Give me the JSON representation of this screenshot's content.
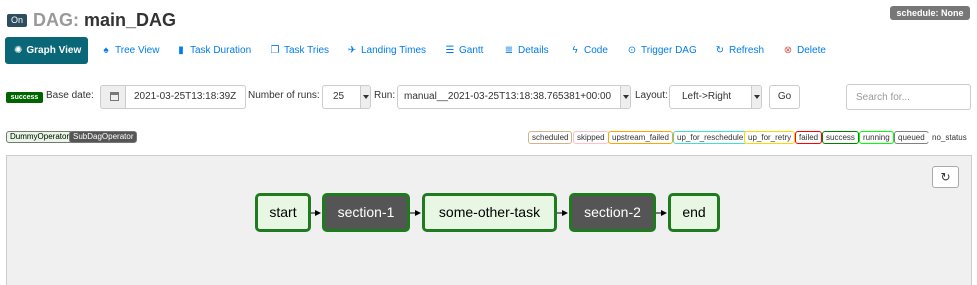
{
  "header": {
    "toggle_label": "On",
    "title_prefix": "DAG:",
    "dag_id": "main_DAG",
    "schedule_badge": "schedule: None"
  },
  "nav": {
    "items": [
      {
        "label": "Graph View",
        "icon": "asterisk-icon",
        "active": true
      },
      {
        "label": "Tree View",
        "icon": "tree-icon"
      },
      {
        "label": "Task Duration",
        "icon": "bar-chart-icon"
      },
      {
        "label": "Task Tries",
        "icon": "files-icon"
      },
      {
        "label": "Landing Times",
        "icon": "plane-icon"
      },
      {
        "label": "Gantt",
        "icon": "gantt-icon"
      },
      {
        "label": "Details",
        "icon": "list-icon"
      },
      {
        "label": "Code",
        "icon": "flash-icon"
      },
      {
        "label": "Trigger DAG",
        "icon": "play-circle-icon"
      },
      {
        "label": "Refresh",
        "icon": "refresh-icon"
      },
      {
        "label": "Delete",
        "icon": "remove-circle-icon"
      }
    ]
  },
  "form": {
    "state_badge": "success",
    "base_date_label": "Base date:",
    "base_date_value": "2021-03-25T13:18:39Z",
    "num_runs_label": "Number of runs:",
    "num_runs_value": "25",
    "run_label": "Run:",
    "run_value": "manual__2021-03-25T13:18:38.765381+00:00",
    "layout_label": "Layout:",
    "layout_value": "Left->Right",
    "go_label": "Go",
    "search_placeholder": "Search for..."
  },
  "operators": [
    {
      "label": "DummyOperator",
      "color": "#e8f7e4",
      "text_color": "#000000"
    },
    {
      "label": "SubDagOperator",
      "color": "#555555",
      "text_color": "#ffffff"
    }
  ],
  "states": [
    {
      "label": "scheduled",
      "color": "#d2b48c"
    },
    {
      "label": "skipped",
      "color": "#ffc0cb"
    },
    {
      "label": "upstream_failed",
      "color": "#ffa500"
    },
    {
      "label": "up_for_reschedule",
      "color": "#40e0d0"
    },
    {
      "label": "up_for_retry",
      "color": "#ffd700"
    },
    {
      "label": "failed",
      "color": "#ff0000"
    },
    {
      "label": "success",
      "color": "#008000"
    },
    {
      "label": "running",
      "color": "#00ff00"
    },
    {
      "label": "queued",
      "color": "#808080"
    },
    {
      "label": "no_status",
      "color": "#ffffff"
    }
  ],
  "graph": {
    "nodes": [
      {
        "id": "start",
        "label": "start",
        "type": "DummyOperator",
        "state": "success"
      },
      {
        "id": "section-1",
        "label": "section-1",
        "type": "SubDagOperator",
        "state": "success"
      },
      {
        "id": "some-other-task",
        "label": "some-other-task",
        "type": "DummyOperator",
        "state": "success"
      },
      {
        "id": "section-2",
        "label": "section-2",
        "type": "SubDagOperator",
        "state": "success"
      },
      {
        "id": "end",
        "label": "end",
        "type": "DummyOperator",
        "state": "success"
      }
    ]
  },
  "colors": {
    "nav_active": "#096777",
    "link": "#017cee",
    "success_border": "#1e7b1e"
  }
}
